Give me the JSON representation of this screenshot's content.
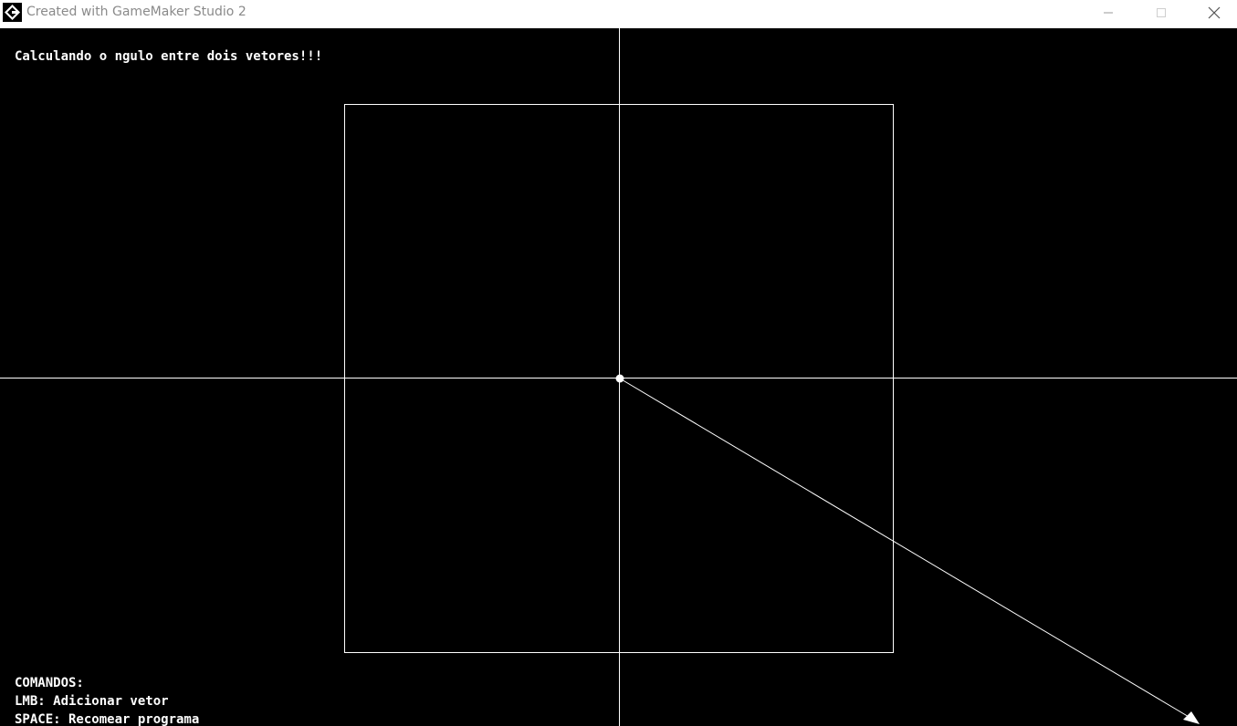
{
  "window": {
    "title": "Created with GameMaker Studio 2",
    "icon": "gamemaker-icon",
    "controls": [
      "minimize-icon",
      "maximize-icon",
      "close-icon"
    ]
  },
  "game": {
    "heading": "Calculando o ngulo entre dois vetores!!!",
    "commands_title": "COMANDOS:",
    "commands": [
      "LMB: Adicionar vetor",
      "SPACE: Recomear programa"
    ]
  },
  "colors": {
    "background": "#000000",
    "foreground": "#ffffff",
    "titlebar": "#ffffff",
    "title_text": "#8a8a8a"
  }
}
